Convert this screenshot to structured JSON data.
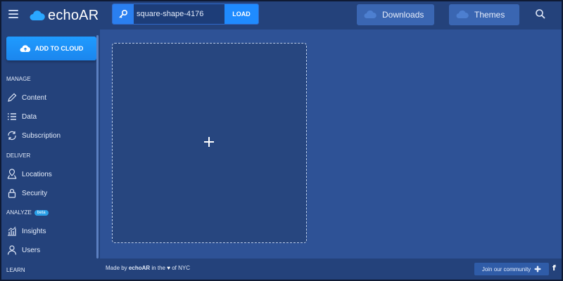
{
  "app": {
    "name": "echoAR"
  },
  "header": {
    "menu_icon": "hamburger-icon",
    "key_icon": "key-icon",
    "api_key_value": "square-shape-4176",
    "load_label": "LOAD",
    "downloads_label": "Downloads",
    "themes_label": "Themes",
    "search_icon": "search-icon"
  },
  "sidebar": {
    "add_to_cloud_label": "ADD TO CLOUD",
    "sections": {
      "manage": "MANAGE",
      "deliver": "DELIVER",
      "analyze": "ANALYZE",
      "analyze_badge": "beta",
      "learn": "LEARN"
    },
    "items": [
      {
        "label": "Content",
        "icon": "pencil-icon"
      },
      {
        "label": "Data",
        "icon": "list-icon"
      },
      {
        "label": "Subscription",
        "icon": "refresh-icon"
      },
      {
        "label": "Locations",
        "icon": "map-pin-icon"
      },
      {
        "label": "Security",
        "icon": "lock-icon"
      },
      {
        "label": "Insights",
        "icon": "bar-chart-icon"
      },
      {
        "label": "Users",
        "icon": "user-icon"
      }
    ]
  },
  "main": {
    "upload_icon": "plus-icon"
  },
  "footer": {
    "made_by_prefix": "Made by",
    "brand": "echoAR",
    "in_the": "in the",
    "of_nyc": "of NYC",
    "community_label": "Join our community",
    "facebook_glyph": "f"
  },
  "colors": {
    "bar_bg": "#24427b",
    "content_bg": "#2e5296",
    "accent": "#1f8bff",
    "text": "#e4ecfa"
  }
}
